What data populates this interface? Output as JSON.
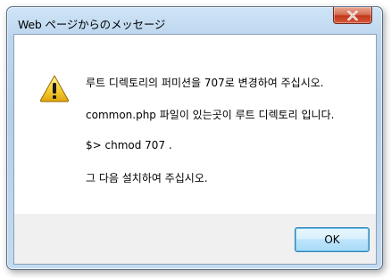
{
  "window": {
    "title": "Web ページからのメッセージ"
  },
  "dialog": {
    "icon": "warning-icon",
    "messages": [
      "루트 디렉토리의 퍼미션을 707로 변경하여 주십시오.",
      "common.php 파일이 있는곳이 루트 디렉토리 입니다.",
      "$> chmod 707 .",
      "그 다음 설치하여 주십시오."
    ],
    "ok_label": "OK"
  }
}
